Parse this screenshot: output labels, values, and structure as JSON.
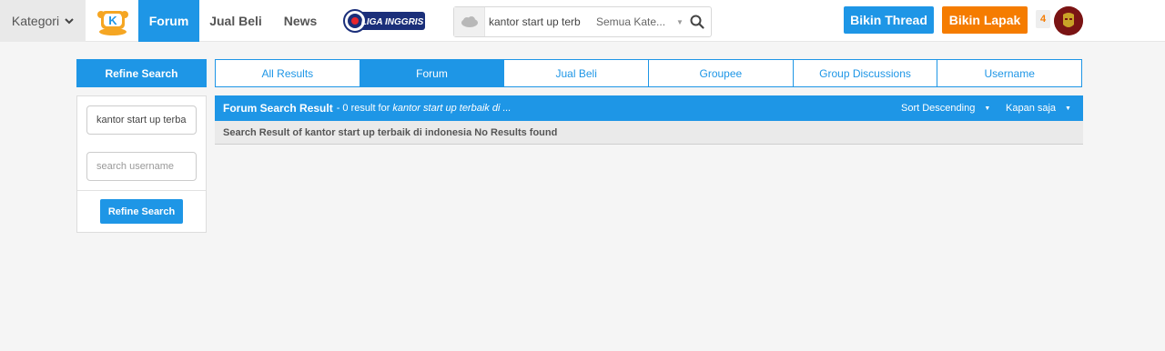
{
  "header": {
    "kategori_label": "Kategori",
    "nav": {
      "forum": "Forum",
      "jual_beli": "Jual Beli",
      "news": "News"
    },
    "liga_logo_text": "LIGA INGGRIS",
    "search": {
      "value": "kantor start up terb",
      "category": "Semua Kate..."
    },
    "bikin_thread": "Bikin Thread",
    "bikin_lapak": "Bikin Lapak",
    "notification_count": "4"
  },
  "sidebar": {
    "title": "Refine Search",
    "query_value": "kantor start up terbaik di indonesia",
    "username_placeholder": "search username",
    "button_label": "Refine Search"
  },
  "tabs": [
    {
      "label": "All Results",
      "active": false
    },
    {
      "label": "Forum",
      "active": true
    },
    {
      "label": "Jual Beli",
      "active": false
    },
    {
      "label": "Groupee",
      "active": false
    },
    {
      "label": "Group Discussions",
      "active": false
    },
    {
      "label": "Username",
      "active": false
    }
  ],
  "results": {
    "title": "Forum Search Result",
    "count_text": "- 0 result for",
    "query_text": "kantor start up terbaik di ...",
    "sort_label": "Sort Descending",
    "time_label": "Kapan saja",
    "no_result_text": "Search Result of kantor start up terbaik di indonesia No Results found"
  },
  "colors": {
    "primary": "#1e96e6",
    "orange": "#f57c00",
    "background": "#f5f5f5"
  }
}
